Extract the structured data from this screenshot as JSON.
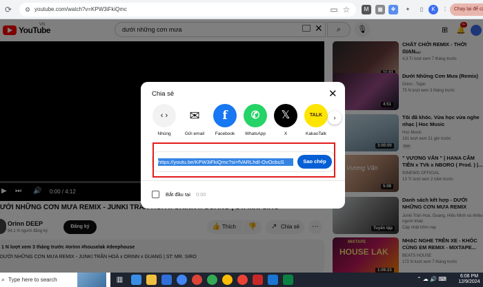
{
  "browser": {
    "url": "youtube.com/watch?v=KPW3iFkiQmc",
    "update_label": "Chạy lại để cập nhật"
  },
  "header": {
    "logo_text": "YouTube",
    "region": "VN",
    "search_value": "dưới những cơn mưa",
    "notification_count": "9+"
  },
  "player": {
    "time": "0:00 / 4:12"
  },
  "video": {
    "title": "ƯỚI NHỮNG CƠN MƯA REMIX - JUNKI TRẦN HOÀ x ORINN x GUANG | ST: MR. SIRO",
    "channel": "Orinn DEEP",
    "subscribers": "94,1 N người đăng ký",
    "subscribe_label": "Đăng ký",
    "like_label": "Thích",
    "share_label": "Chia sẻ",
    "meta": "1 N lượt xem  3 tháng trước  #orinn #houselak #deephouse",
    "description": "DƯỚI NHỮNG CƠN MƯA REMIX - JUNKI TRẦN HOÀ x ORINN x GUANG | ST: MR. SIRO"
  },
  "recommendations": [
    {
      "title": "CHẤT CHỚI REMIX - THỜI GIAN...",
      "channel": "KC official",
      "views": "4,3 Tr lượt xem  7 tháng trước",
      "duration": "11:01",
      "badge": ""
    },
    {
      "title": "Dưới Những Cơn Mưa (Remix)",
      "channel": "Orinn - Topic",
      "views": "75 N lượt xem  3 tháng trước",
      "duration": "4:51",
      "badge": ""
    },
    {
      "title": "Tôi đã khóc. Vừa học vừa nghe nhạc | Hoc Music",
      "channel": "Hoc Music",
      "views": "161 lượt xem  21 giờ trước",
      "duration": "3:00:00",
      "badge": "Mới"
    },
    {
      "title": "\" VƯƠNG VẤN \" | HANA CẨM TIÊN x TVk x NBORO ( Prod. ) |...",
      "channel": "93NEWG OFFICIAL",
      "views": "13 Tr lượt xem  2 năm trước",
      "duration": "5:08",
      "badge": ""
    },
    {
      "title": "Danh sách kết hợp - DƯỚI NHỮNG CƠN MƯA REMIX",
      "channel": "Junki Trần Hoà, Guang, Hiếu Minh và nhiều người khác",
      "views": "Cập nhật hôm nay",
      "duration": "",
      "badge": "Tuyển tập"
    },
    {
      "title": "NHẠC NGHE TRÊN XE - KHÓC CÙNG EM REMIX - MIXTAPE...",
      "channel": "BEATS HOUSE",
      "views": "172 N lượt xem  7 tháng trước",
      "duration": "1:09:23",
      "badge": ""
    }
  ],
  "thumb_texts": {
    "houselak": "HOUSE LAK",
    "mixtape": "MIXTAPE",
    "vuong_van": "Vương Vấn"
  },
  "share_dialog": {
    "title": "Chia sẻ",
    "options": [
      {
        "label": "Nhúng"
      },
      {
        "label": "Gửi email"
      },
      {
        "label": "Facebook"
      },
      {
        "label": "WhatsApp"
      },
      {
        "label": "X"
      },
      {
        "label": "KakaoTalk"
      }
    ],
    "kakao_icon_text": "TALK",
    "link": "https://youtu.be/KPW3iFkiQmc?si=fVARLhdI-OvOcbuS",
    "copy_label": "Sao chép",
    "start_label": "Bắt đầu tại",
    "start_time": "0:00"
  },
  "taskbar": {
    "search_placeholder": "Type here to search",
    "time": "6:08 PM",
    "date": "12/9/2024"
  },
  "colors": {
    "yt_red": "#ff0000",
    "copy_blue": "#065fd4",
    "highlight_red": "#e21a1a",
    "facebook": "#1877f2",
    "whatsapp": "#25d366",
    "kakao": "#fee500"
  }
}
